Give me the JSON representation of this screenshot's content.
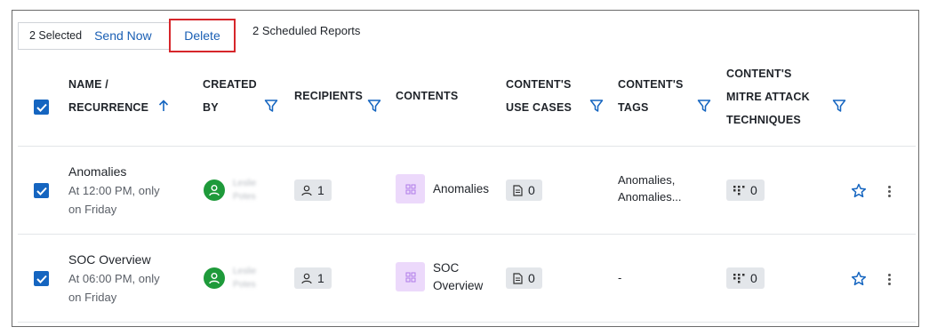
{
  "toolbar": {
    "selected_label": "2 Selected",
    "send_now_label": "Send Now",
    "delete_label": "Delete",
    "scheduled_label": "2 Scheduled Reports"
  },
  "columns": {
    "name_line1": "NAME /",
    "name_line2": "RECURRENCE",
    "created_line1": "CREATED",
    "created_line2": "BY",
    "recipients": "RECIPIENTS",
    "contents": "CONTENTS",
    "use_cases_line1": "CONTENT'S",
    "use_cases_line2": "USE CASES",
    "tags_line1": "CONTENT'S",
    "tags_line2": "TAGS",
    "mitre_line1": "CONTENT'S",
    "mitre_line2": "MITRE ATTACK",
    "mitre_line3": "TECHNIQUES"
  },
  "rows": [
    {
      "name": "Anomalies",
      "recurrence_line1": "At 12:00 PM, only",
      "recurrence_line2": "on Friday",
      "creator_line1": "Leslie",
      "creator_line2": "Potes",
      "recipients": "1",
      "contents_line1": "Anomalies",
      "contents_line2": "",
      "use_cases": "0",
      "tags_line1": "Anomalies,",
      "tags_line2": "Anomalies...",
      "mitre": "0",
      "selected": true
    },
    {
      "name": "SOC Overview",
      "recurrence_line1": "At 06:00 PM, only",
      "recurrence_line2": "on Friday",
      "creator_line1": "Leslie",
      "creator_line2": "Potes",
      "recipients": "1",
      "contents_line1": "SOC",
      "contents_line2": "Overview",
      "use_cases": "0",
      "tags_line1": "-",
      "tags_line2": "",
      "mitre": "0",
      "selected": true
    }
  ],
  "colors": {
    "accent": "#1565c0",
    "link": "#1a5fb4",
    "highlight_border": "#d6262b",
    "avatar": "#1e9a3a",
    "dashboard_tile": "#ecd9fb"
  },
  "icons": [
    "filter-icon",
    "sort-arrow-up-icon",
    "user-icon",
    "dashboard-icon",
    "document-icon",
    "mitre-matrix-icon",
    "star-icon",
    "kebab-menu-icon",
    "checkbox-icon"
  ]
}
